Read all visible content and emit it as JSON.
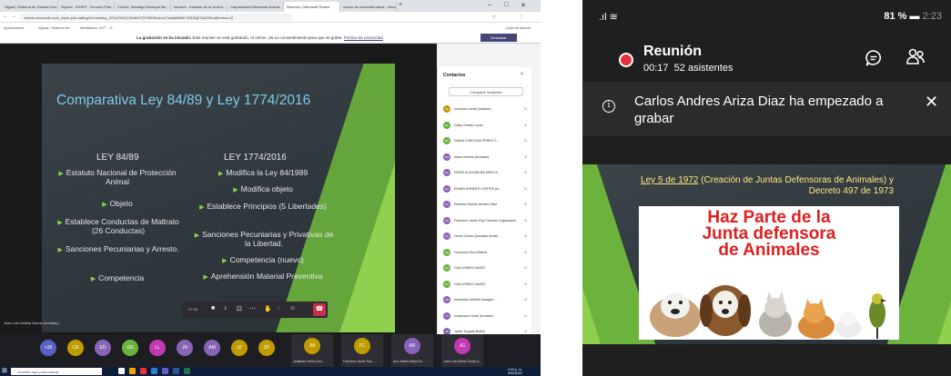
{
  "desktop": {
    "browser": {
      "tabs": [
        "Signal | Sistema de Gestión Doc...",
        "Signed - SIGEP - Función Públ...",
        "Correo: Santiago Montoya Mu...",
        "Intranet - Instituto de la Juvent...",
        "Capacitación Bienestar Animal...",
        "Reunión | Microsoft Teams",
        "correo de sociedad salvar - Busca..."
      ],
      "url": "teams.microsoft.com/_#/pre-join-calling/19:meeting_NTk1ZWQ1ODIhNTZlYS00NmUxLTlmNjktMWY4ODBjZTA2ODIx@thread.v2",
      "bookmarks": [
        "Aplicaciones",
        "Signal | Sistema de...",
        "Mediastics 7477 - fi..."
      ],
      "reading_list": "Lista de lectura"
    },
    "recording_banner": {
      "bold": "La grabación se ha iniciado.",
      "text": "Esta reunión se está grabando. Al unirse, da su consentimiento para que se grabe.",
      "link": "Política de privacidad",
      "button": "Descartar"
    },
    "slide": {
      "title": "Comparativa Ley 84/89 y Ley 1774/2016",
      "left_head": "LEY 84/89",
      "right_head": "LEY 1774/2016",
      "left_items": [
        "Estatuto Nacional de Protección Animal",
        "Objeto",
        "Establece Conductas de Maltrato (26 Conductas)",
        "Sanciones Pecuniarias y Arresto.",
        "Competencia"
      ],
      "right_items": [
        "Modifica la Ley 84/1989",
        "Modifica objeto",
        "Establece Principios (5 Libertades)",
        "Sanciones Pecuniarias y Privativas de la Libertad.",
        "Competencia (nuevo)",
        "Aprehensión Material Preventiva"
      ]
    },
    "presenter_name": "Juan Luis Molina Osorio (Invitado)",
    "call_time": "07:25",
    "contacts": {
      "title": "Contactos",
      "share_button": "Compartir invitación",
      "list": [
        {
          "initials": "CR",
          "name": "consuelo rueda (Invitado)",
          "color": "#c19c00"
        },
        {
          "initials": "DL",
          "name": "Daisy Oviedo Lopez",
          "color": "#6bb33c"
        },
        {
          "initials": "DC",
          "name": "DIANA CAROLINA PEREZ C...",
          "color": "#6bb33c"
        },
        {
          "initials": "DM",
          "name": "diana moreno (Invitado)",
          "color": "#8764b8"
        },
        {
          "initials": "DA",
          "name": "DORIS ALEXANDRA MERCA...",
          "color": "#8764b8"
        },
        {
          "initials": "EC",
          "name": "EDWIN INFANTE CORTES (In...",
          "color": "#8764b8"
        },
        {
          "initials": "EN",
          "name": "Esteban Nicolás Álvarez Diaz",
          "color": "#8764b8"
        },
        {
          "initials": "FR",
          "name": "Francisco Javier Rey Cáceres Organizador",
          "color": "#8764b8"
        },
        {
          "initials": "GQ",
          "name": "Geam Carlos Quesada (Invita...",
          "color": "#8764b8"
        },
        {
          "initials": "GM",
          "name": "Giovanna Mora Molina",
          "color": "#6bb33c"
        },
        {
          "initials": "GN",
          "name": "GUILLERMO NUAEZ",
          "color": "#6bb33c"
        },
        {
          "initials": "GN",
          "name": "GUILLERMO NUAEZ",
          "color": "#6bb33c"
        },
        {
          "initials": "HB",
          "name": "herneston herbeth baragan ...",
          "color": "#8764b8"
        },
        {
          "initials": "IN",
          "name": "Inspeccion Norte (Invitado)",
          "color": "#8764b8"
        },
        {
          "initials": "JN",
          "name": "Javier Espada Nuñez",
          "color": "#8764b8"
        },
        {
          "initials": "JA",
          "name": "Javier Hernando Albarracín ...",
          "color": "#8764b8"
        }
      ]
    },
    "gallery": {
      "avatars": [
        {
          "initials": "+38",
          "color": "#5b5fc7"
        },
        {
          "initials": "CR",
          "color": "#c19c00"
        },
        {
          "initials": "ED",
          "color": "#8764b8"
        },
        {
          "initials": "GN",
          "color": "#6bb33c"
        },
        {
          "initials": "LL",
          "color": "#c239b3"
        },
        {
          "initials": "JN",
          "color": "#8764b8"
        },
        {
          "initials": "AM",
          "color": "#8764b8"
        },
        {
          "initials": "JZ",
          "color": "#c19c00"
        },
        {
          "initials": "ZP",
          "color": "#c19c00"
        }
      ],
      "tiles": [
        {
          "initials": "JM",
          "name": "Jonathan muñoz (Inv...",
          "color": "#c19c00"
        },
        {
          "initials": "FC",
          "name": "Francisco Javier Rey ...",
          "color": "#c19c00"
        },
        {
          "initials": "AR",
          "name": "Ana Valeria Mejía Ro...",
          "color": "#8764b8"
        },
        {
          "initials": "JG",
          "name": "Juan Luis Molina Osorio (I...",
          "color": "#c239b3"
        }
      ]
    },
    "taskbar": {
      "search": "Escribe aquí para buscar",
      "time": "2:23 p. m.",
      "date": "9/02/2022"
    }
  },
  "phone": {
    "status": {
      "battery": "81 %",
      "time": "2:23"
    },
    "meeting": {
      "title": "Reunión",
      "elapsed": "00:17",
      "attendees": "52 asistentes"
    },
    "notification": {
      "text": "Carlos Andres Ariza Diaz ha empezado a grabar"
    },
    "slide": {
      "law_link": "Ley 5 de 1972",
      "law_text": " (Creación de Juntas Defensoras de Animales) y Decreto 497 de 1973",
      "poster_line1": "Haz Parte de la",
      "poster_line2": "Junta defensora",
      "poster_line3": "de Animales"
    }
  },
  "colors": {
    "slide_bg": "#2f383d",
    "slide_green": "#6bb33c",
    "slide_title": "#7fc9e8",
    "teams_purple": "#464775",
    "rec_red": "#e8313a",
    "poster_red": "#e0201f",
    "law_yellow": "#ffe680"
  }
}
